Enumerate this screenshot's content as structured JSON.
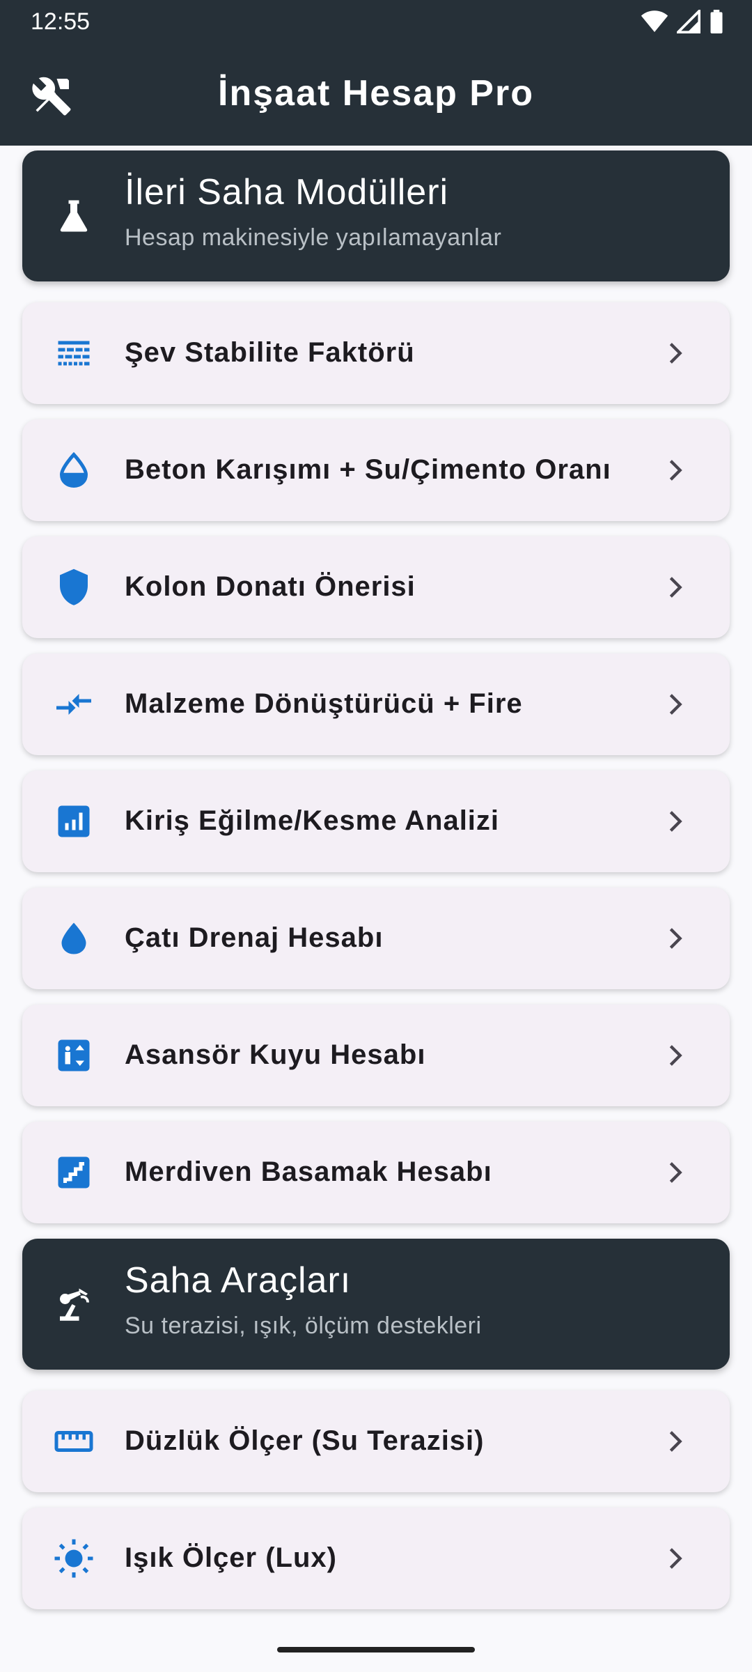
{
  "status_bar": {
    "time": "12:55"
  },
  "app_bar": {
    "title": "İnşaat Hesap Pro",
    "icon": "tools-icon"
  },
  "sections": [
    {
      "title": "İleri Saha Modülleri",
      "subtitle": "Hesap makinesiyle yapılamayanlar",
      "icon": "flask-icon",
      "items": [
        {
          "label": "Şev Stabilite Faktörü",
          "icon": "layers-icon"
        },
        {
          "label": "Beton Karışımı + Su/Çimento Oranı",
          "icon": "water-drop-icon"
        },
        {
          "label": "Kolon Donatı Önerisi",
          "icon": "shield-icon"
        },
        {
          "label": "Malzeme Dönüştürücü + Fire",
          "icon": "compare-arrows-icon"
        },
        {
          "label": "Kiriş Eğilme/Kesme Analizi",
          "icon": "analytics-icon"
        },
        {
          "label": "Çatı Drenaj Hesabı",
          "icon": "drop-icon"
        },
        {
          "label": "Asansör Kuyu Hesabı",
          "icon": "elevator-icon"
        },
        {
          "label": "Merdiven Basamak Hesabı",
          "icon": "stairs-icon"
        }
      ]
    },
    {
      "title": "Saha Araçları",
      "subtitle": "Su terazisi, ışık, ölçüm destekleri",
      "icon": "precision-tool-icon",
      "items": [
        {
          "label": "Düzlük Ölçer (Su Terazisi)",
          "icon": "ruler-icon"
        },
        {
          "label": "Işık Ölçer (Lux)",
          "icon": "sun-icon"
        }
      ]
    }
  ],
  "colors": {
    "header_bg": "#263038",
    "card_bg": "#f4eff6",
    "accent": "#1976d2"
  }
}
